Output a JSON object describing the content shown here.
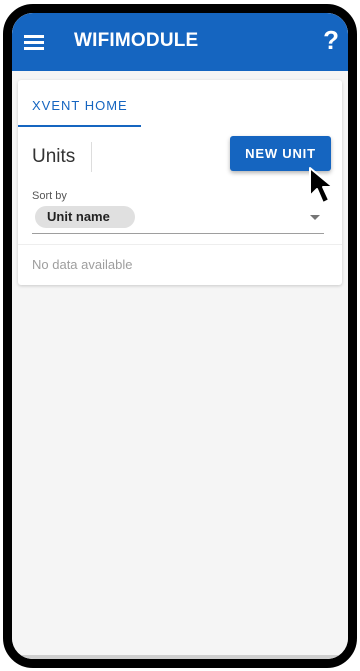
{
  "appbar": {
    "title": "WIFIMODULE",
    "help_symbol": "?",
    "color": "#1565c0",
    "menu_icon": "hamburger-menu-icon"
  },
  "tabs": [
    {
      "label": "XVENT HOME",
      "active": true
    }
  ],
  "units": {
    "title": "Units",
    "new_unit_label": "NEW UNIT"
  },
  "sort": {
    "label": "Sort by",
    "selected": "Unit name"
  },
  "list": {
    "empty_text": "No data available"
  },
  "cursor": {
    "icon": "mouse-pointer-icon"
  }
}
